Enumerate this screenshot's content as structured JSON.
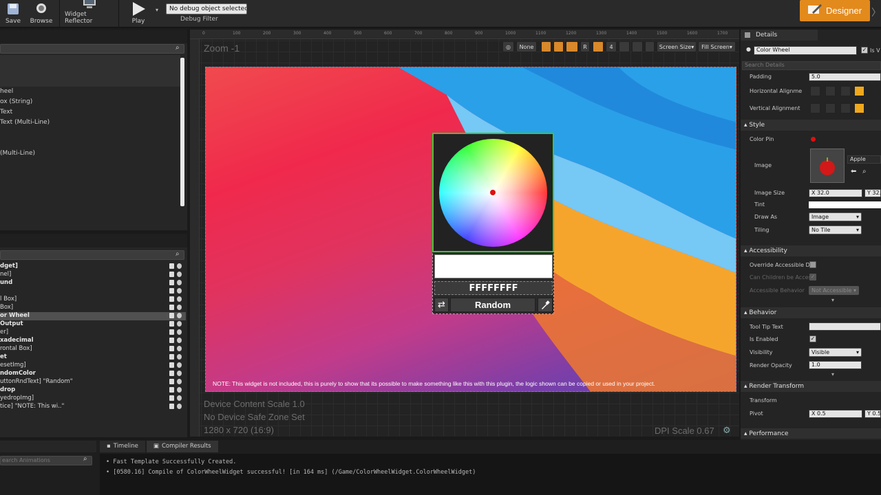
{
  "toolbar": {
    "save": "Save",
    "browse": "Browse",
    "widget_reflector": "Widget Reflector",
    "play": "Play",
    "debug_select": "No debug object selected ▾",
    "debug_filter": "Debug Filter",
    "designer": "Designer"
  },
  "palette": {
    "items": [
      "heel",
      "ox (String)",
      "Text",
      "Text (Multi-Line)",
      "(Multi-Line)"
    ]
  },
  "hierarchy": {
    "rows": [
      {
        "label": "dget]",
        "bold": true
      },
      {
        "label": "nel]",
        "bold": false
      },
      {
        "label": "und",
        "bold": true
      },
      {
        "label": "",
        "bold": false
      },
      {
        "label": "l Box]",
        "bold": false
      },
      {
        "label": "Box]",
        "bold": false
      },
      {
        "label": "or Wheel",
        "bold": true,
        "selected": true
      },
      {
        "label": "Output",
        "bold": true
      },
      {
        "label": "er]",
        "bold": false
      },
      {
        "label": "xadecimal",
        "bold": true
      },
      {
        "label": "rontal Box]",
        "bold": false
      },
      {
        "label": "et",
        "bold": true
      },
      {
        "label": "esetImg]",
        "bold": false
      },
      {
        "label": "ndomColor",
        "bold": true
      },
      {
        "label": "uttonRndText] \"Random\"",
        "bold": false
      },
      {
        "label": "drop",
        "bold": true
      },
      {
        "label": "yedropImg]",
        "bold": false
      },
      {
        "label": "tice] \"NOTE: This wi..\"",
        "bold": false
      }
    ]
  },
  "canvas": {
    "zoom": "Zoom -1",
    "none_label": "None",
    "r_label": "R",
    "four_label": "4",
    "screen_size": "Screen Size▾",
    "fill_screen": "Fill Screen▾",
    "ruler": [
      "0",
      "100",
      "200",
      "300",
      "400",
      "500",
      "600",
      "700",
      "800",
      "900",
      "1000",
      "1100",
      "1200",
      "1300",
      "1400",
      "1500",
      "1600",
      "1700"
    ],
    "device_scale": "Device Content Scale 1.0",
    "safe_zone": "No Device Safe Zone Set",
    "resolution": "1280 x 720 (16:9)",
    "dpi": "DPI Scale 0.67",
    "note": "NOTE: This widget is not included, this is purely to show that its possible to make something like this with this plugin, the logic shown can be copied or used in your project."
  },
  "color_widget": {
    "hex": "FFFFFFFF",
    "random": "Random",
    "swatch_color": "#ffffff",
    "pin_color": "#dd1111"
  },
  "details": {
    "title": "Details",
    "name_value": "Color Wheel",
    "is_var": "Is V",
    "search_placeholder": "Search Details",
    "padding_label": "Padding",
    "padding_value": "5.0",
    "h_align_label": "Horizontal Alignme",
    "v_align_label": "Vertical Alignment",
    "style_section": "Style",
    "color_pin_label": "Color Pin",
    "image_label": "Image",
    "image_asset": "Apple",
    "image_size_label": "Image Size",
    "image_size_x": "X  32.0",
    "image_size_y": "Y  32.",
    "tint_label": "Tint",
    "draw_as_label": "Draw As",
    "draw_as_value": "Image",
    "tiling_label": "Tiling",
    "tiling_value": "No Tile",
    "accessibility_section": "Accessibility",
    "override_label": "Override Accessible D",
    "children_label": "Can Children be Acces",
    "acc_behavior_label": "Accessible Behavior",
    "acc_behavior_value": "Not Accessible",
    "behavior_section": "Behavior",
    "tooltip_label": "Tool Tip Text",
    "enabled_label": "Is Enabled",
    "visibility_label": "Visibility",
    "visibility_value": "Visible",
    "opacity_label": "Render Opacity",
    "opacity_value": "1.0",
    "render_transform_section": "Render Transform",
    "transform_label": "Transform",
    "pivot_label": "Pivot",
    "pivot_x": "X  0.5",
    "pivot_y": "Y  0.5",
    "performance_section": "Performance"
  },
  "bottom": {
    "timeline_tab": "Timeline",
    "compiler_tab": "Compiler Results",
    "search_anim_placeholder": "earch Animations",
    "log": [
      "Fast Template Successfully Created.",
      "[0580.16] Compile of ColorWheelWidget successful! [in 164 ms] (/Game/ColorWheelWidget.ColorWheelWidget)"
    ]
  }
}
